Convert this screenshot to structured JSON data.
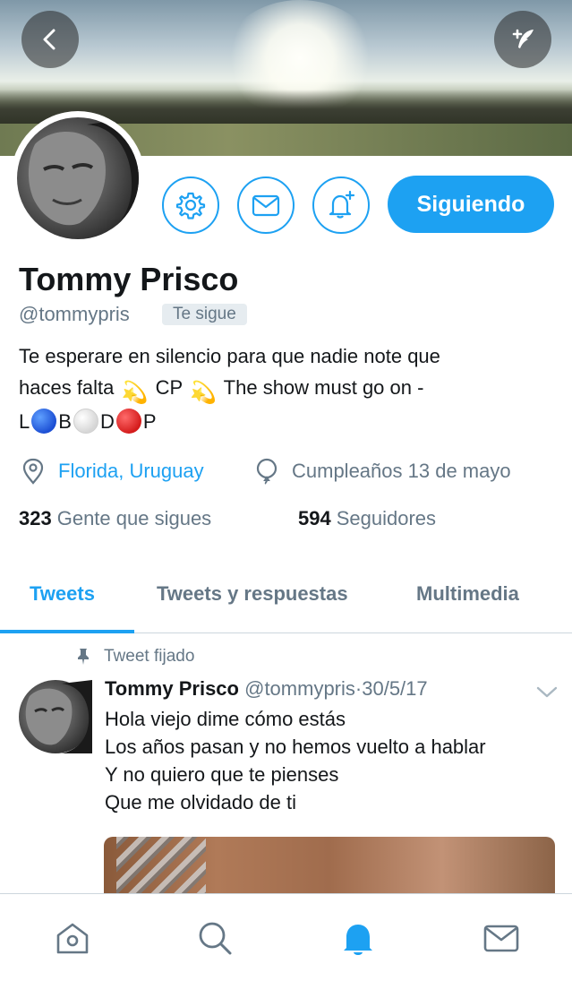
{
  "profile": {
    "name": "Tommy Prisco",
    "handle": "@tommypris",
    "follows_you": "Te sigue",
    "bio_line1": "Te esperare en silencio para que nadie note que",
    "bio_line2_a": "haces falta",
    "bio_line2_b": "CP",
    "bio_line2_c": "The show must go on -",
    "bio_line3_l": "L",
    "bio_line3_b": "B",
    "bio_line3_d": "D",
    "bio_line3_p": "P",
    "location": "Florida, Uruguay",
    "birthday": "Cumpleaños 13 de mayo",
    "following_count": "323",
    "following_label": "Gente que sigues",
    "followers_count": "594",
    "followers_label": "Seguidores"
  },
  "actions": {
    "follow_label": "Siguiendo"
  },
  "tabs": [
    {
      "label": "Tweets",
      "active": true
    },
    {
      "label": "Tweets y respuestas",
      "active": false
    },
    {
      "label": "Multimedia",
      "active": false
    }
  ],
  "tweet": {
    "pinned_label": "Tweet fijado",
    "author_name": "Tommy Prisco",
    "author_handle": "@tommypris",
    "separator": "·",
    "date": "30/5/17",
    "lines": [
      "Hola viejo dime cómo estás",
      "Los años pasan y no hemos vuelto a hablar",
      "Y no quiero que te pienses",
      "Que me olvidado de ti"
    ]
  },
  "icons": {
    "back": "back-arrow-icon",
    "compose": "compose-tweet-icon",
    "settings": "gear-icon",
    "message": "envelope-icon",
    "notify": "bell-plus-icon",
    "location": "location-pin-icon",
    "birthday": "balloon-icon",
    "pin": "pin-icon",
    "nav": [
      "home-icon",
      "search-icon",
      "bell-icon",
      "mail-icon"
    ]
  },
  "colors": {
    "accent": "#1da1f2",
    "text": "#14171a",
    "secondary": "#657786",
    "border": "#ccd6dd"
  }
}
